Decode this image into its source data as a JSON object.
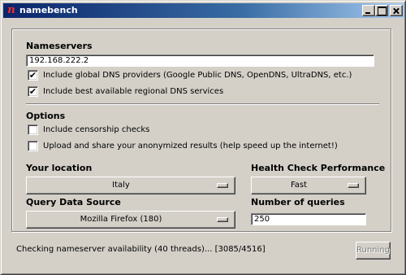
{
  "window": {
    "title": "namebench",
    "app_icon_glyph": "n",
    "app_icon_color": "#ff2a2a"
  },
  "nameservers": {
    "heading": "Nameservers",
    "value": "192.168.222.2",
    "include_global_label": "Include global DNS providers (Google Public DNS, OpenDNS, UltraDNS, etc.)",
    "include_global_checked": true,
    "include_regional_label": "Include best available regional DNS services",
    "include_regional_checked": true
  },
  "options": {
    "heading": "Options",
    "censorship_label": "Include censorship checks",
    "censorship_checked": false,
    "upload_label": "Upload and share your anonymized results (help speed up the internet!)",
    "upload_checked": false
  },
  "location": {
    "heading": "Your location",
    "value": "Italy"
  },
  "health": {
    "heading": "Health Check Performance",
    "value": "Fast"
  },
  "query_source": {
    "heading": "Query Data Source",
    "value": "Mozilla Firefox (180)"
  },
  "queries": {
    "heading": "Number of queries",
    "value": "250"
  },
  "status": {
    "text": "Checking nameserver availability (40 threads)... [3085/4516]",
    "button_label": "Running"
  },
  "check_glyph": "✔"
}
